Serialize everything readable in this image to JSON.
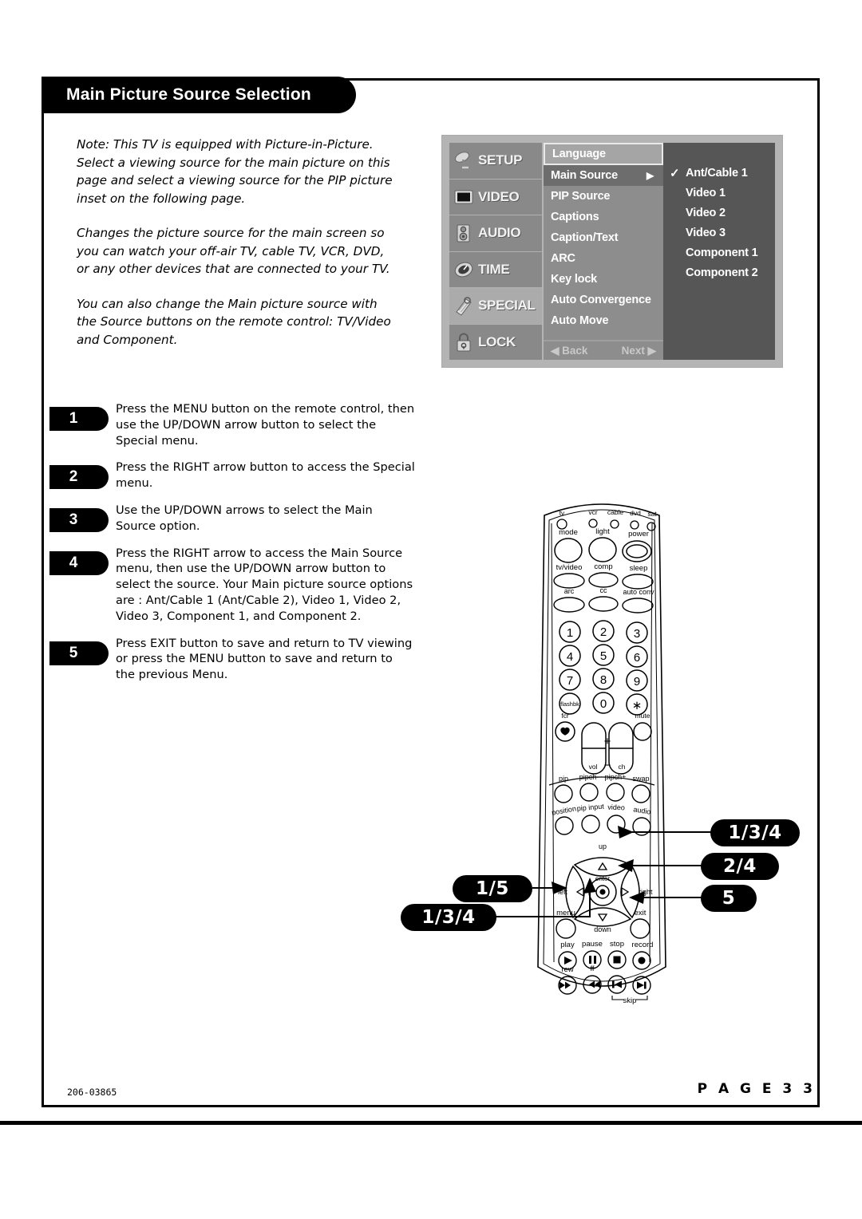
{
  "page": {
    "title": "Main Picture Source Selection",
    "footer_code": "206-03865",
    "footer_page": "P A G E  3 3"
  },
  "intro": {
    "p1": "Note: This TV is equipped with Picture-in-Picture. Select a viewing source for the main picture on this page and select a viewing source for the PIP picture inset on the following page.",
    "p2": "Changes the picture source for the main screen so you can watch your off-air TV, cable TV, VCR, DVD, or any other devices that are connected to your TV.",
    "p3": "You can also change the Main picture source with the Source buttons on the remote control: TV/Video and Component."
  },
  "osd": {
    "sidebar": [
      {
        "label": "SETUP",
        "icon": "satellite-dish-icon",
        "active": false
      },
      {
        "label": "VIDEO",
        "icon": "screen-icon",
        "active": false
      },
      {
        "label": "AUDIO",
        "icon": "speaker-icon",
        "active": false
      },
      {
        "label": "TIME",
        "icon": "clock-icon",
        "active": false
      },
      {
        "label": "SPECIAL",
        "icon": "tag-icon",
        "active": true
      },
      {
        "label": "LOCK",
        "icon": "padlock-icon",
        "active": false
      }
    ],
    "menu": [
      {
        "label": "Language",
        "state": "boxed"
      },
      {
        "label": "Main Source",
        "state": "selected",
        "arrow": "▶"
      },
      {
        "label": "PIP Source",
        "state": "normal"
      },
      {
        "label": "Captions",
        "state": "normal"
      },
      {
        "label": "Caption/Text",
        "state": "normal"
      },
      {
        "label": "ARC",
        "state": "normal"
      },
      {
        "label": "Key lock",
        "state": "normal"
      },
      {
        "label": "Auto Convergence",
        "state": "normal"
      },
      {
        "label": "Auto Move",
        "state": "normal"
      }
    ],
    "nav": {
      "back": "◀ Back",
      "next": "Next ▶"
    },
    "options": [
      {
        "label": "Ant/Cable 1",
        "checked": true,
        "check": "✓"
      },
      {
        "label": "Video 1",
        "checked": false,
        "check": ""
      },
      {
        "label": "Video 2",
        "checked": false,
        "check": ""
      },
      {
        "label": "Video 3",
        "checked": false,
        "check": ""
      },
      {
        "label": "Component 1",
        "checked": false,
        "check": ""
      },
      {
        "label": "Component 2",
        "checked": false,
        "check": ""
      }
    ]
  },
  "steps": [
    {
      "num": "1",
      "text": "Press the MENU button on the remote control, then use the UP/DOWN arrow button to select the Special menu."
    },
    {
      "num": "2",
      "text": "Press the RIGHT arrow button to access the Special menu."
    },
    {
      "num": "3",
      "text": "Use the UP/DOWN arrows to select the Main Source option."
    },
    {
      "num": "4",
      "text": "Press the RIGHT arrow to access the Main Source menu, then use the UP/DOWN arrow button to select the source. Your Main picture source options are : Ant/Cable 1 (Ant/Cable 2), Video 1, Video 2, Video 3, Component 1, and Component 2."
    },
    {
      "num": "5",
      "text": "Press EXIT button to save and return to TV viewing or press the MENU button to save and return to the previous Menu."
    }
  ],
  "callouts": {
    "up": "1/3/4",
    "right": "2/4",
    "exit": "5",
    "menu": "1/5",
    "down": "1/3/4"
  },
  "remote": {
    "mode_leds": [
      "tv",
      "vcr",
      "cable",
      "dvd",
      "sat"
    ],
    "row_mode": [
      "mode",
      "light",
      "power"
    ],
    "row_source": [
      "tv/video",
      "comp",
      "sleep"
    ],
    "row_arc": [
      "arc",
      "cc",
      "auto conv"
    ],
    "keypad": [
      "1",
      "2",
      "3",
      "4",
      "5",
      "6",
      "7",
      "8",
      "9",
      "flashbk",
      "0",
      "∗"
    ],
    "fcr_label": "fcr",
    "mute_label": "mute",
    "vol_label": "vol",
    "ch_label": "ch",
    "plus_label": "+",
    "minus_label": "−",
    "row_pip": [
      "pip",
      "pipch-",
      "pipch+",
      "swap"
    ],
    "row_position": [
      "position",
      "pip input",
      "video",
      "audio"
    ],
    "nav": {
      "up": "up",
      "down": "down",
      "left": "left",
      "right": "right",
      "enter": "enter",
      "menu": "menu",
      "exit": "exit"
    },
    "row_transport": [
      "play",
      "pause",
      "stop",
      "record"
    ],
    "row_transport2": [
      "rew",
      "ff"
    ],
    "skip_label": "skip"
  }
}
